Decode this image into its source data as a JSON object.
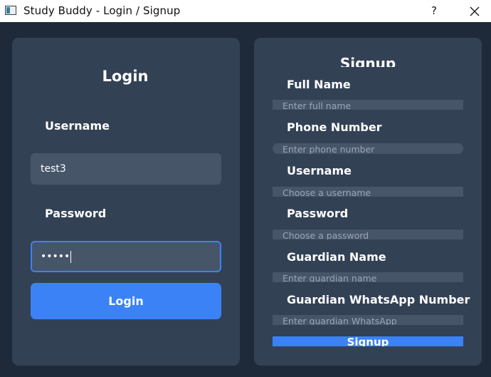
{
  "window": {
    "title": "Study Buddy - Login / Signup",
    "help_label": "?"
  },
  "login": {
    "heading": "Login",
    "username_label": "Username",
    "username_value": "test3",
    "password_label": "Password",
    "password_value": "•••••",
    "button_label": "Login"
  },
  "signup": {
    "heading": "Signup",
    "fields": [
      {
        "label": "Full Name",
        "placeholder": "Enter full name"
      },
      {
        "label": "Phone Number",
        "placeholder": "Enter phone number"
      },
      {
        "label": "Username",
        "placeholder": "Choose a username"
      },
      {
        "label": "Password",
        "placeholder": "Choose a password"
      },
      {
        "label": "Guardian Name",
        "placeholder": "Enter guardian name"
      },
      {
        "label": "Guardian WhatsApp Number",
        "placeholder": "Enter guardian WhatsApp"
      }
    ],
    "button_label": "Signup"
  },
  "colors": {
    "background": "#1e2a3a",
    "panel": "#334155",
    "input": "#475569",
    "accent": "#3b82f6"
  },
  "icons": {
    "app": "app-icon",
    "close": "close-icon"
  }
}
